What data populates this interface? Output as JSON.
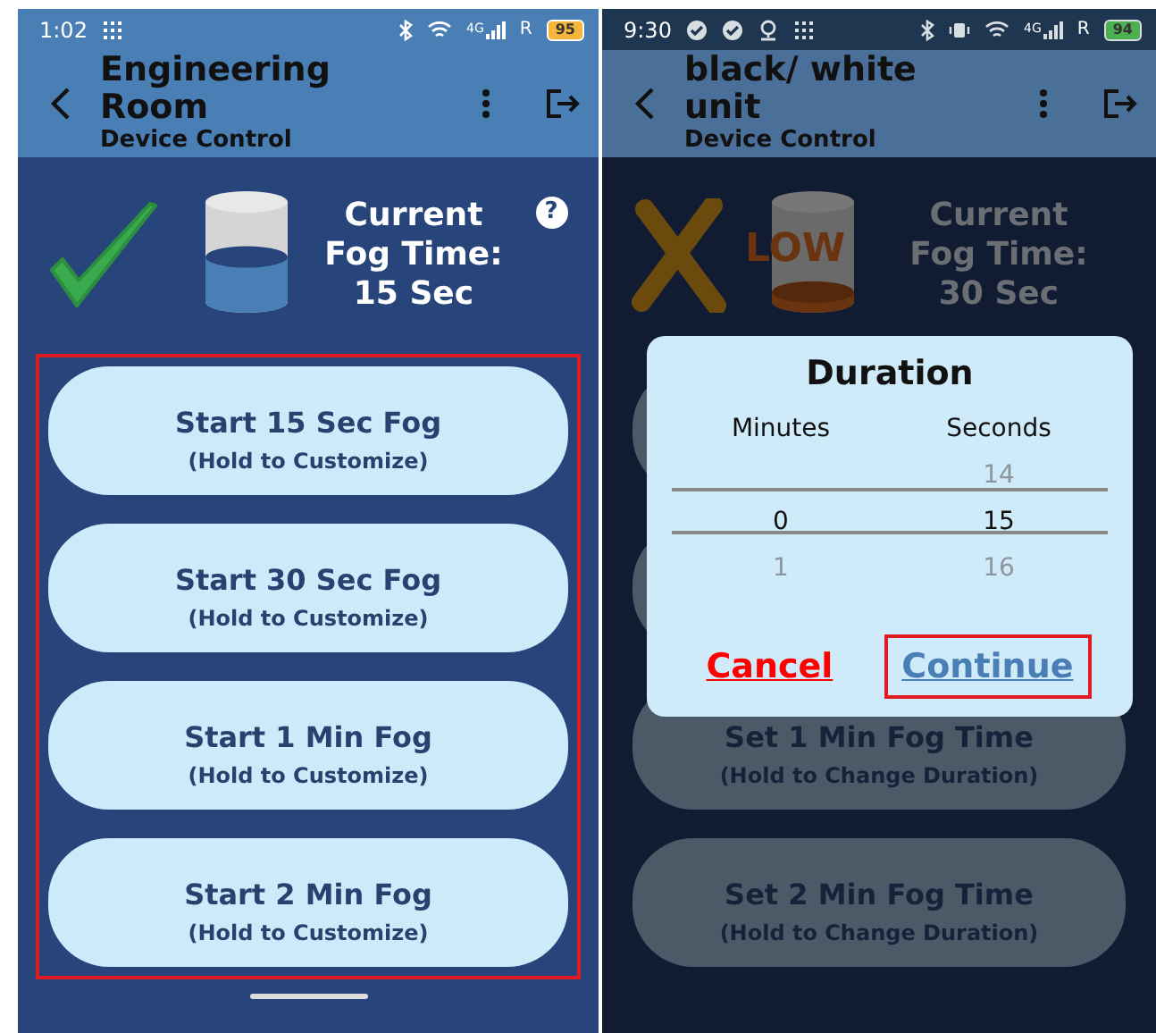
{
  "phones": [
    {
      "dimmed": false,
      "status_bar": {
        "time": "1:02",
        "notice_icons": [
          {
            "kind": "grid"
          }
        ],
        "network": "4G",
        "roaming": "R",
        "battery": "95"
      },
      "header": {
        "title": "Engineering Room",
        "subtitle": "Device Control"
      },
      "device": {
        "ready": true,
        "tank_low": false,
        "fog_label": "Current Fog Time:",
        "fog_value": "15 Sec",
        "help": "?"
      },
      "buttons_highlighted": true,
      "buttons": [
        {
          "kind": "labeled",
          "title": "Start 15 Sec Fog",
          "hint": "(Hold to Customize)"
        },
        {
          "kind": "labeled",
          "title": "Start 30 Sec Fog",
          "hint": "(Hold to Customize)"
        },
        {
          "kind": "labeled",
          "title": "Start 1 Min Fog",
          "hint": "(Hold to Customize)"
        },
        {
          "kind": "labeled",
          "title": "Start 2 Min Fog",
          "hint": "(Hold to Customize)"
        }
      ],
      "home_bar": true
    },
    {
      "dimmed": true,
      "status_bar": {
        "time": "9:30",
        "notice_icons": [
          {
            "kind": "check"
          },
          {
            "kind": "check"
          },
          {
            "kind": "pin"
          },
          {
            "kind": "grid"
          }
        ],
        "network": "4G",
        "roaming": "R",
        "battery": "94"
      },
      "header": {
        "title": "black/ white unit",
        "subtitle": "Device Control"
      },
      "device": {
        "ready": false,
        "tank_low": true,
        "tank_label": "LOW",
        "fog_label": "Current Fog Time:",
        "fog_value": "30 Sec"
      },
      "buttons_highlighted": false,
      "buttons": [
        {
          "kind": "covered"
        },
        {
          "kind": "covered"
        },
        {
          "kind": "labeled",
          "title": "Set 1 Min Fog Time",
          "hint": "(Hold to Change Duration)"
        },
        {
          "kind": "labeled",
          "title": "Set 2 Min Fog Time",
          "hint": "(Hold to Change Duration)"
        }
      ],
      "home_bar": false,
      "dialog": {
        "title": "Duration",
        "columns": [
          {
            "heading": "Minutes",
            "values": [
              {
                "value": "0",
                "selected": true
              },
              {
                "value": "1",
                "selected": false
              }
            ]
          },
          {
            "heading": "Seconds",
            "values": [
              {
                "value": "14",
                "selected": false
              },
              {
                "value": "15",
                "selected": true
              },
              {
                "value": "16",
                "selected": false
              }
            ]
          }
        ],
        "actions": [
          {
            "label": "Cancel",
            "kind": "cancel",
            "highlighted": false
          },
          {
            "label": "Continue",
            "kind": "confirm",
            "highlighted": true
          }
        ]
      }
    }
  ]
}
